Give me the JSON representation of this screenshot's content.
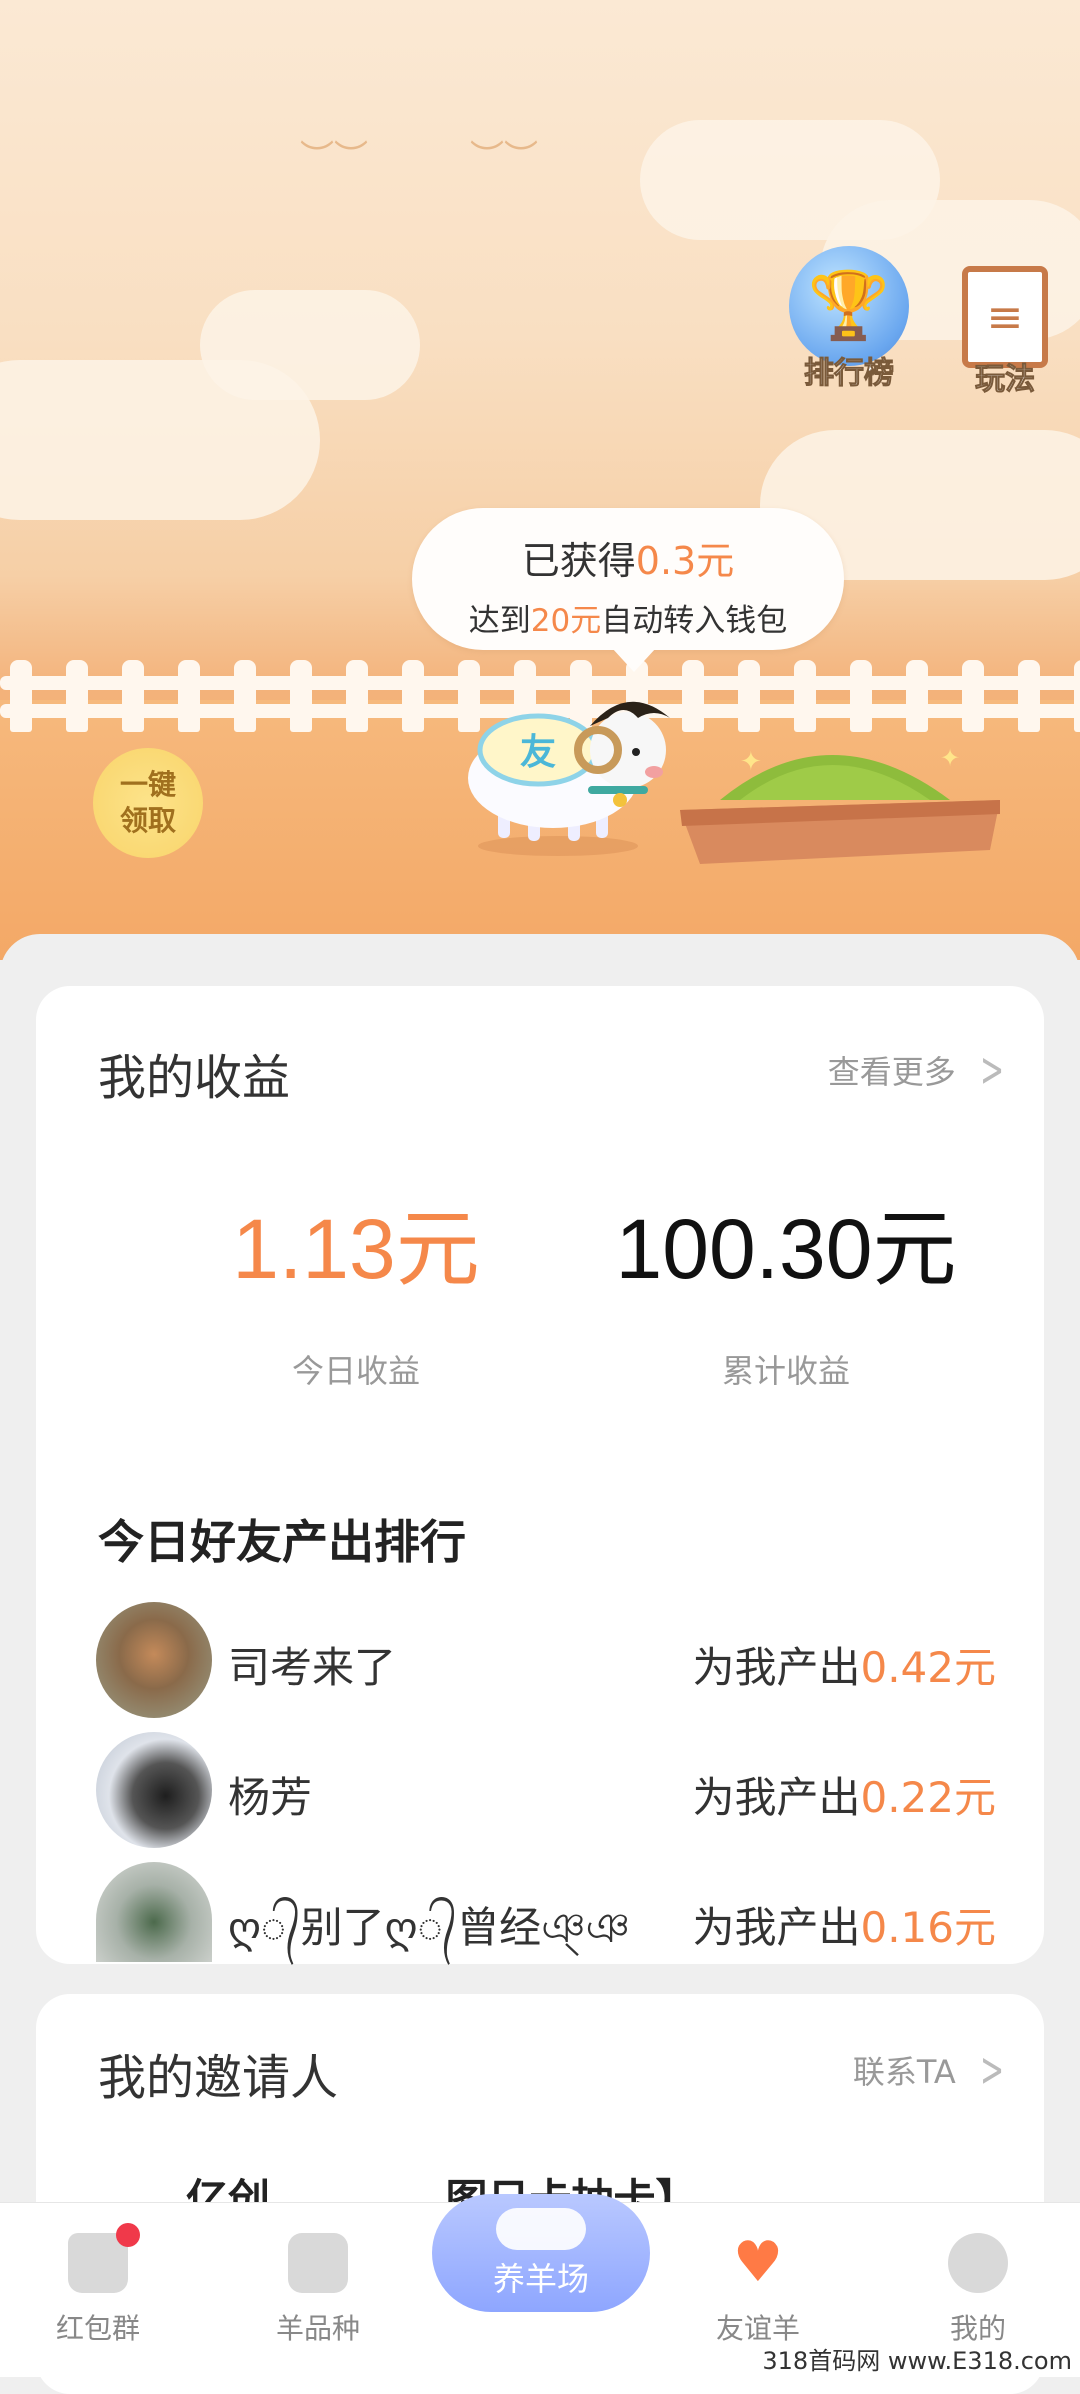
{
  "hero": {
    "ranking_label": "排行榜",
    "rules_label": "玩法",
    "bubble": {
      "earned_prefix": "已获得",
      "earned_amount": "0.3元",
      "reach_prefix": "达到",
      "reach_amount": "20元",
      "reach_suffix": "自动转入钱包"
    },
    "collect_line1": "一键",
    "collect_line2": "领取",
    "sheep_badge": "友"
  },
  "earnings": {
    "title": "我的收益",
    "more_label": "查看更多",
    "today_value": "1.13元",
    "today_label": "今日收益",
    "total_value": "100.30元",
    "total_label": "累计收益",
    "ranking_title": "今日好友产出排行",
    "friends": [
      {
        "name": "司考来了",
        "prefix": "为我产出",
        "amount": "0.42元"
      },
      {
        "name": "杨芳",
        "prefix": "为我产出",
        "amount": "0.22元"
      },
      {
        "name": "ღ᭄别了ღ᭄曾经ঞ্ঞ",
        "prefix": "为我产出",
        "amount": "0.16元"
      }
    ]
  },
  "inviter": {
    "title": "我的邀请人",
    "contact_label": "联系TA",
    "partial_text": "亿创            图日卡抽卡】"
  },
  "tabbar": {
    "tabs": [
      {
        "label": "红包群"
      },
      {
        "label": "羊品种"
      },
      {
        "label": "养羊场"
      },
      {
        "label": "友谊羊"
      },
      {
        "label": "我的"
      }
    ]
  },
  "watermark": "318首码网 www.E318.com",
  "colors": {
    "accent_orange": "#f5884a",
    "tab_active_bg": "#8ea6ff",
    "badge_red": "#f0394a"
  }
}
